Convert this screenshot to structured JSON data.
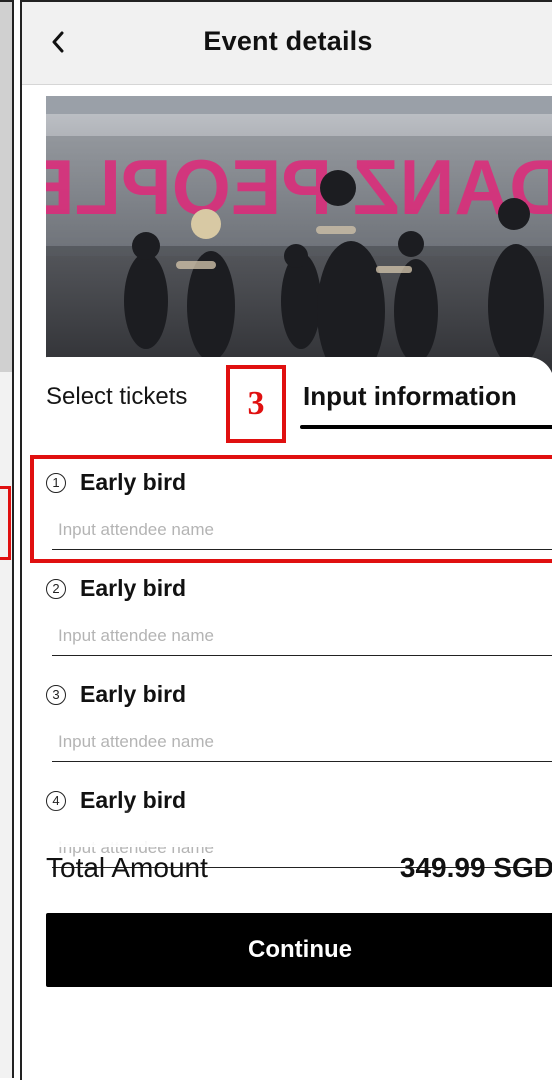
{
  "header": {
    "back_icon": "chevron-left-icon",
    "title": "Event details"
  },
  "event_image": {
    "sign_text": "DANZ PEOPLE"
  },
  "tabs": {
    "select_tickets": "Select tickets",
    "input_information": "Input information",
    "active": "input_information"
  },
  "annotation": {
    "step_number": "3",
    "color": "#e01010"
  },
  "tickets": [
    {
      "number": "1",
      "name": "Early bird",
      "placeholder": "Input attendee name",
      "value": ""
    },
    {
      "number": "2",
      "name": "Early bird",
      "placeholder": "Input attendee name",
      "value": ""
    },
    {
      "number": "3",
      "name": "Early bird",
      "placeholder": "Input attendee name",
      "value": ""
    },
    {
      "number": "4",
      "name": "Early bird",
      "placeholder": "Input attendee name",
      "value": ""
    }
  ],
  "summary": {
    "total_label": "Total Amount",
    "total_amount": "349.99 SGD"
  },
  "actions": {
    "continue_label": "Continue"
  },
  "colors": {
    "header_bg": "#f1f1f1",
    "button_bg": "#000000",
    "annotation": "#e01010"
  }
}
